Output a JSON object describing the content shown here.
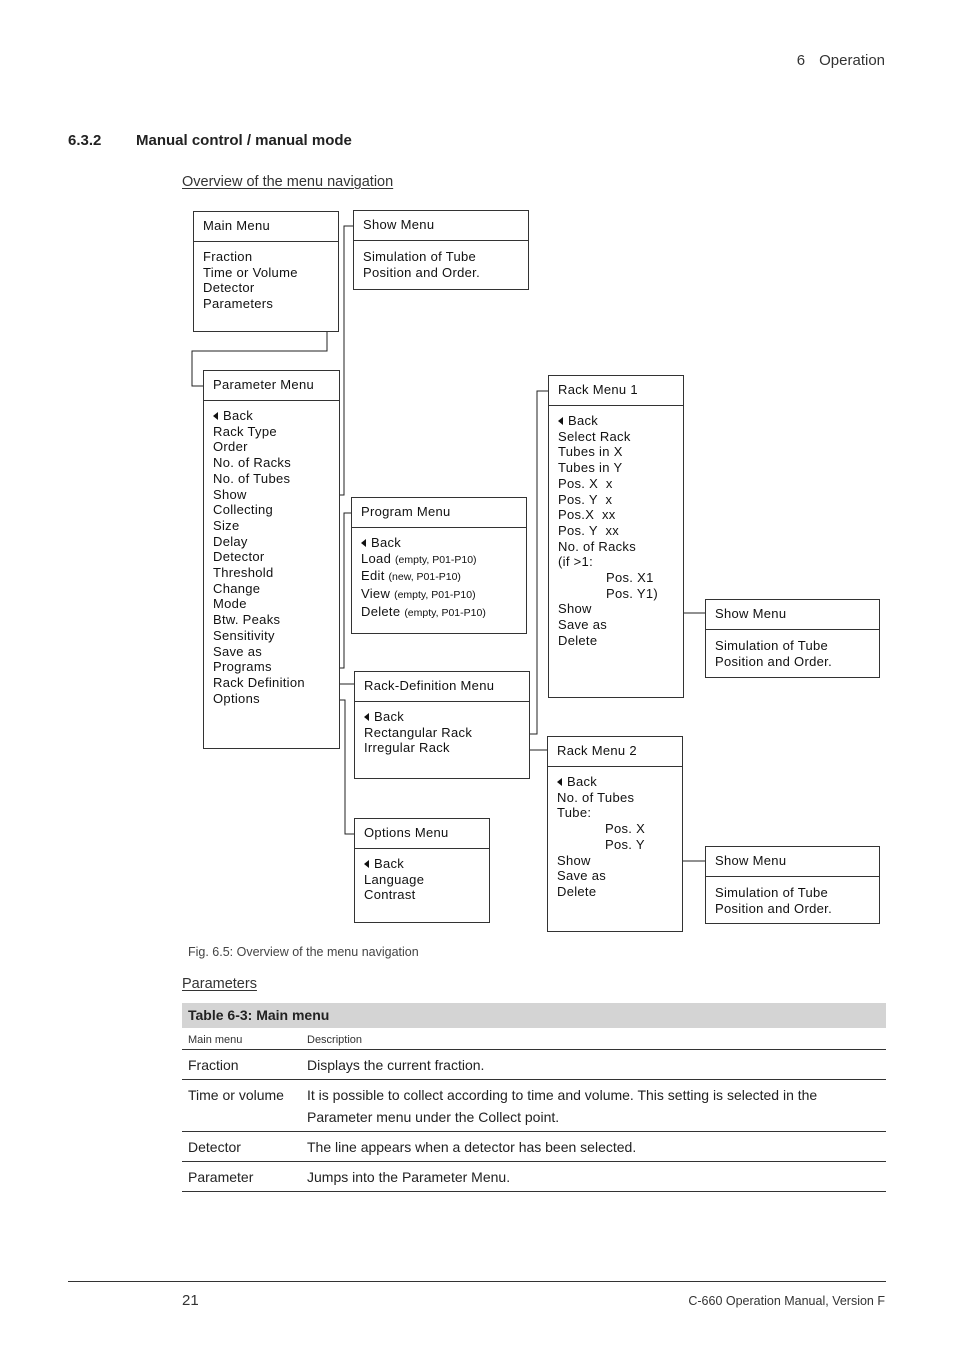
{
  "header": {
    "chapter_number": "6",
    "chapter_title": "Operation"
  },
  "section": {
    "number": "6.3.2",
    "title": "Manual control / manual mode"
  },
  "subheading": "Overview of the menu navigation",
  "diagram": {
    "main_menu": {
      "title": "Main Menu",
      "items": [
        "Fraction",
        "Time or Volume",
        "Detector",
        "Parameters"
      ]
    },
    "show_menu_top": {
      "title": "Show Menu",
      "lines": [
        "Simulation of Tube",
        "Position and Order."
      ]
    },
    "parameter_menu": {
      "title": "Parameter Menu",
      "items": [
        "Back",
        "Rack Type",
        "Order",
        "No. of Racks",
        "No. of Tubes",
        "Show",
        "Collecting",
        "Size",
        "Delay",
        "Detector",
        "Threshold",
        "Change",
        "Mode",
        "Btw. Peaks",
        "Sensitivity",
        "Save as",
        "Programs",
        "Rack Definition",
        "Options"
      ]
    },
    "program_menu": {
      "title": "Program Menu",
      "items": [
        {
          "label": "Back",
          "note": ""
        },
        {
          "label": "Load",
          "note": "(empty, P01-P10)"
        },
        {
          "label": "Edit",
          "note": "(new, P01-P10)"
        },
        {
          "label": "View",
          "note": "(empty, P01-P10)"
        },
        {
          "label": "Delete",
          "note": "(empty, P01-P10)"
        }
      ]
    },
    "rack_definition_menu": {
      "title": "Rack-Definition Menu",
      "items": [
        "Back",
        "Rectangular Rack",
        "Irregular Rack"
      ]
    },
    "options_menu": {
      "title": "Options Menu",
      "items": [
        "Back",
        "Language",
        "Contrast"
      ]
    },
    "rack_menu_1": {
      "title": "Rack Menu 1",
      "items": [
        "Back",
        "Select Rack",
        "Tubes in X",
        "Tubes in Y",
        "Pos. X  x",
        "Pos. Y  x",
        "Pos.X  xx",
        "Pos. Y  xx",
        "No. of Racks",
        "(if >1:",
        "Pos. X1",
        "Pos. Y1)",
        "Show",
        "Save as",
        "Delete"
      ]
    },
    "show_menu_rack1": {
      "title": "Show Menu",
      "lines": [
        "Simulation of Tube",
        "Position and Order."
      ]
    },
    "rack_menu_2": {
      "title": "Rack Menu 2",
      "items": [
        "Back",
        "No. of Tubes",
        "Tube:",
        "Pos. X",
        "Pos. Y",
        "Show",
        "Save as",
        "Delete"
      ]
    },
    "show_menu_rack2": {
      "title": "Show Menu",
      "lines": [
        "Simulation of Tube",
        "Position and Order."
      ]
    }
  },
  "figure_caption": "Fig. 6.5: Overview of the menu navigation",
  "parameters_heading": "Parameters",
  "table": {
    "caption": "Table 6-3: Main menu",
    "columns": [
      "Main menu",
      "Description"
    ],
    "rows": [
      {
        "menu": "Fraction",
        "description": "Displays the current fraction."
      },
      {
        "menu": "Time or volume",
        "description": "It is possible to collect according to time and volume. This setting is selected in the Parameter menu under the Collect point."
      },
      {
        "menu": "Detector",
        "description": "The line appears when a detector has been selected."
      },
      {
        "menu": "Parameter",
        "description": "Jumps into the Parameter Menu."
      }
    ]
  },
  "footer": {
    "page_number": "21",
    "manual_name": "C-660 Operation Manual, Version F"
  }
}
